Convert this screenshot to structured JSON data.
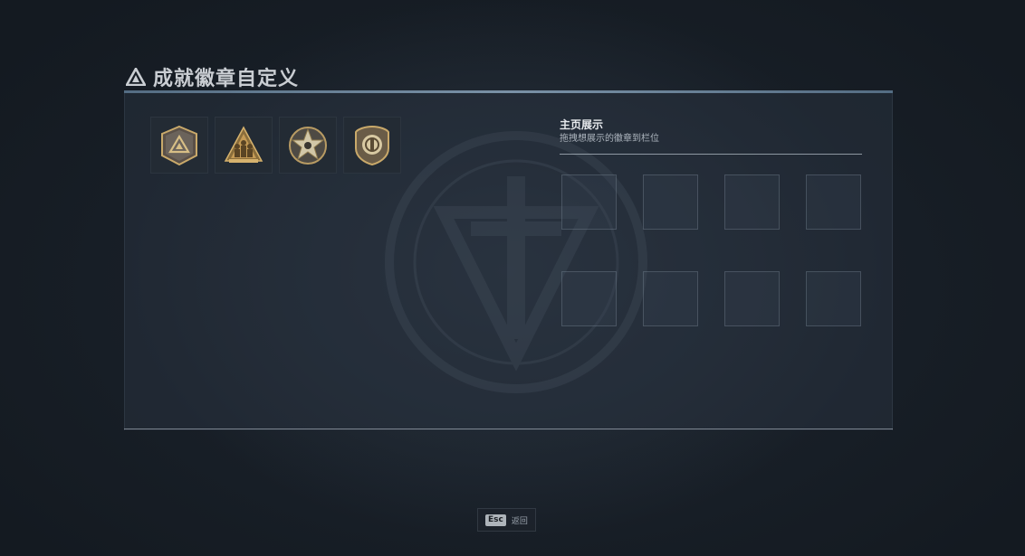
{
  "header": {
    "title": "成就徽章自定义",
    "icon": "triangle-emblem-icon"
  },
  "badges": [
    {
      "name": "delta-shield-badge",
      "icon": "delta-shield-icon"
    },
    {
      "name": "squad-pyramid-badge",
      "icon": "squad-pyramid-icon"
    },
    {
      "name": "star-medal-badge",
      "icon": "star-medal-icon"
    },
    {
      "name": "emblem-shield-badge",
      "icon": "emblem-shield-icon"
    }
  ],
  "showcase": {
    "title": "主页展示",
    "hint": "拖拽想展示的徽章到栏位",
    "slot_count": 8
  },
  "footer": {
    "key": "Esc",
    "label": "返回"
  },
  "colors": {
    "accent_rule": "#8aa4bb",
    "badge_gold": "#c9a96a",
    "background": "#161c23"
  }
}
